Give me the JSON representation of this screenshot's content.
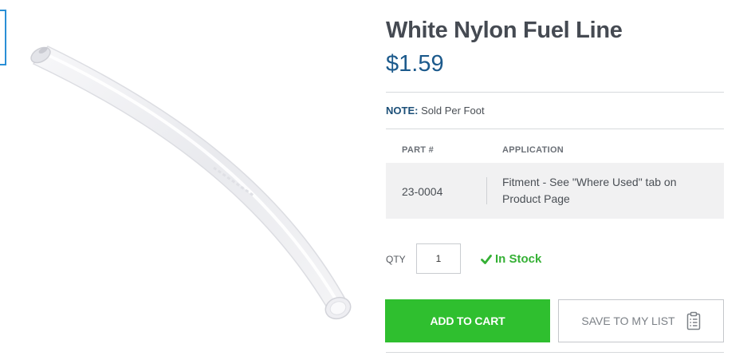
{
  "product": {
    "title": "White Nylon Fuel Line",
    "price": "$1.59",
    "image_alt": "white nylon tube"
  },
  "note": {
    "label": "NOTE:",
    "text": "Sold Per Foot"
  },
  "parts_table": {
    "headers": [
      "PART #",
      "APPLICATION"
    ],
    "rows": [
      {
        "part": "23-0004",
        "application": "Fitment - See \"Where Used\" tab on Product Page"
      }
    ]
  },
  "purchase": {
    "qty_label": "QTY",
    "qty_value": "1",
    "stock_status": "In Stock",
    "stock_icon": "check-icon",
    "add_to_cart_label": "ADD TO CART",
    "save_list_label": "SAVE TO MY LIST",
    "save_list_icon": "clipboard-icon"
  },
  "colors": {
    "price": "#1c5a8c",
    "in_stock": "#35b035",
    "add_to_cart": "#2fbf2f",
    "thumb_border": "#2a8fd6"
  }
}
